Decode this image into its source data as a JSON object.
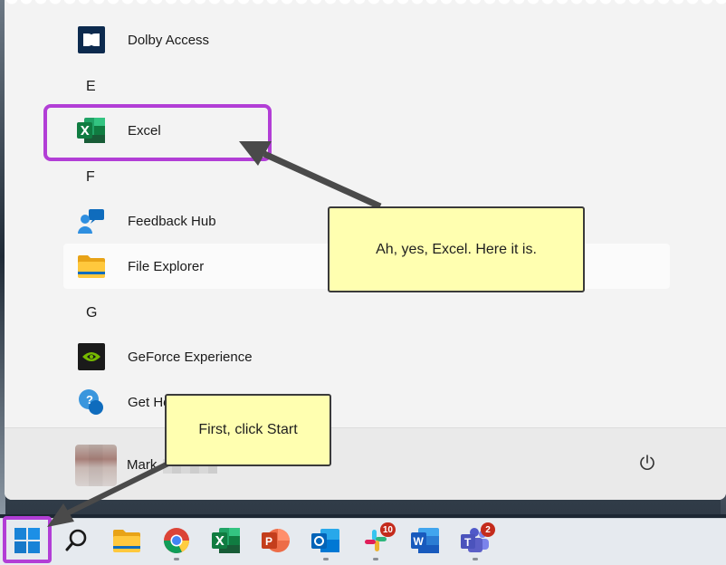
{
  "start_menu": {
    "sections": [
      {
        "letter": "",
        "apps": [
          {
            "name": "Dolby Access",
            "icon": "dolby-icon"
          }
        ]
      },
      {
        "letter": "E",
        "apps": [
          {
            "name": "Excel",
            "icon": "excel-icon"
          }
        ]
      },
      {
        "letter": "F",
        "apps": [
          {
            "name": "Feedback Hub",
            "icon": "feedback-hub-icon"
          },
          {
            "name": "File Explorer",
            "icon": "folder-icon"
          }
        ]
      },
      {
        "letter": "G",
        "apps": [
          {
            "name": "GeForce Experience",
            "icon": "nvidia-icon"
          },
          {
            "name": "Get Help",
            "icon": "get-help-icon"
          }
        ]
      }
    ],
    "user": {
      "name": "Mark"
    },
    "power_icon": "power-icon"
  },
  "callouts": {
    "excel_note": "Ah, yes, Excel.  Here it is.",
    "start_note": "First, click Start"
  },
  "taskbar": {
    "items": [
      {
        "name": "start",
        "icon": "windows-icon"
      },
      {
        "name": "search",
        "icon": "search-icon"
      },
      {
        "name": "file-explorer",
        "icon": "folder-icon"
      },
      {
        "name": "chrome",
        "icon": "chrome-icon"
      },
      {
        "name": "excel",
        "icon": "excel-icon"
      },
      {
        "name": "powerpoint",
        "icon": "powerpoint-icon"
      },
      {
        "name": "outlook",
        "icon": "outlook-icon"
      },
      {
        "name": "slack",
        "icon": "slack-icon",
        "badge": "10"
      },
      {
        "name": "word",
        "icon": "word-icon"
      },
      {
        "name": "teams",
        "icon": "teams-icon",
        "badge": "2"
      }
    ]
  },
  "colors": {
    "highlight": "#b23ed6",
    "callout_bg": "#ffffb0",
    "arrow": "#4a4a4a",
    "badge": "#c42b1c"
  }
}
